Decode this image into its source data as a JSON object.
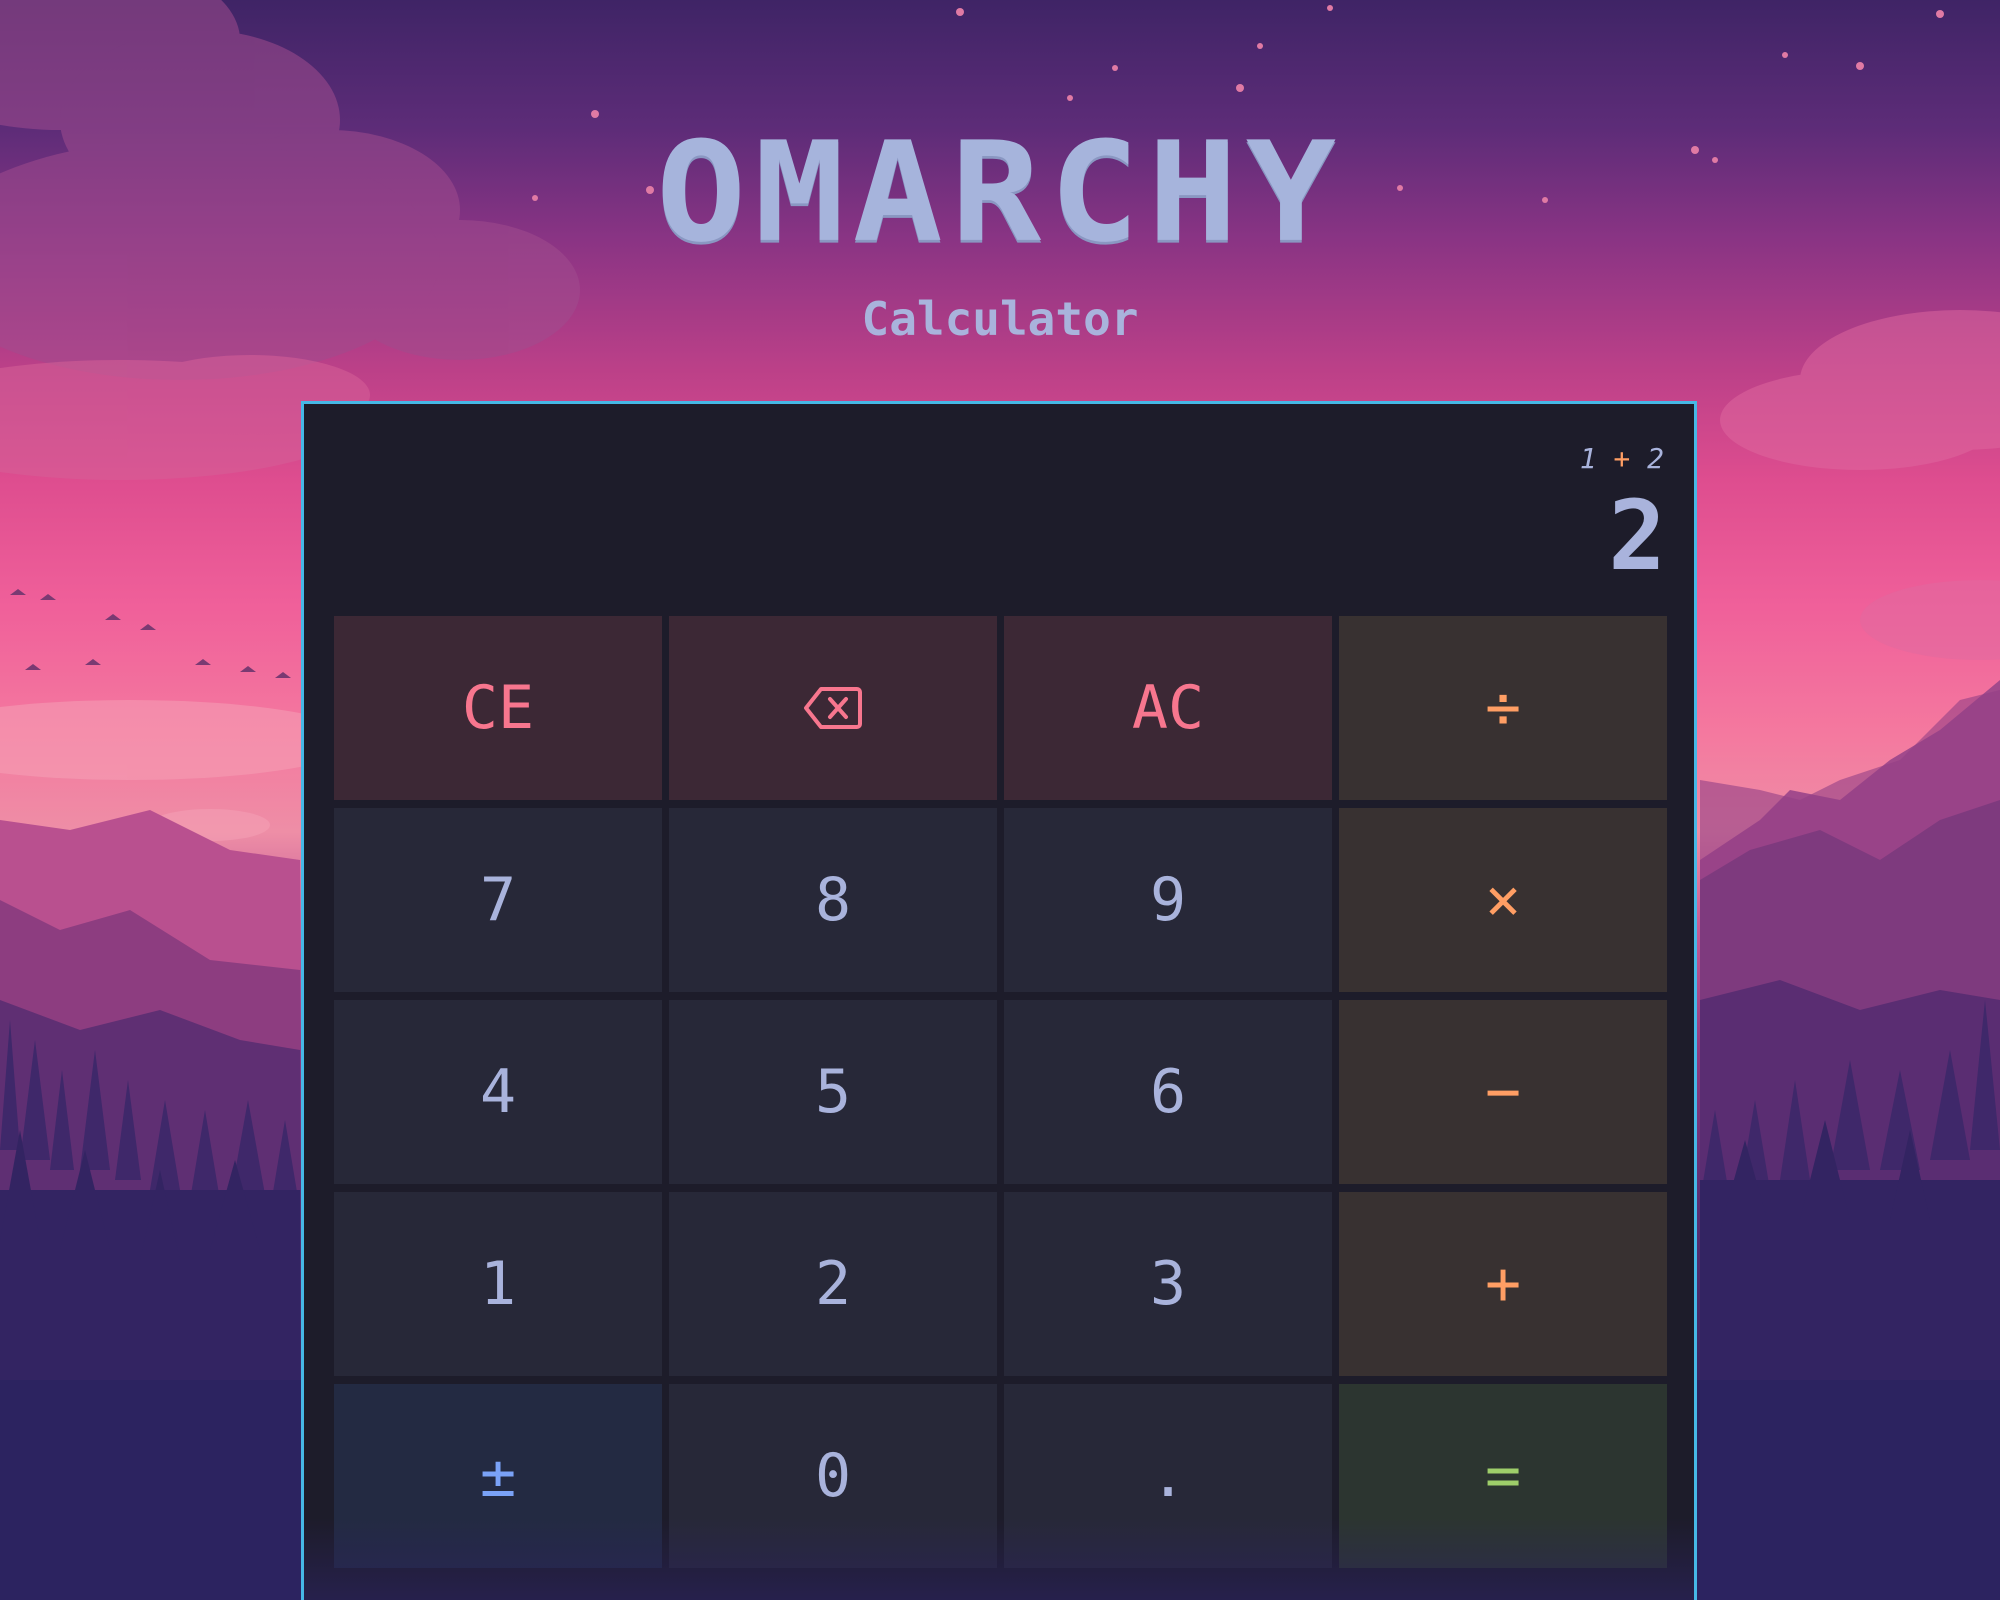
{
  "app": {
    "logo": "OMARCHY",
    "subtitle": "Calculator"
  },
  "display": {
    "expression_left": "1",
    "expression_op": "+",
    "expression_right": "2",
    "result": "2"
  },
  "keys": [
    {
      "label": "CE",
      "kind": "clear",
      "name": "clear-entry-button"
    },
    {
      "label": "",
      "icon": "backspace-icon",
      "kind": "clear",
      "name": "backspace-button"
    },
    {
      "label": "AC",
      "kind": "clear",
      "name": "all-clear-button"
    },
    {
      "label": "÷",
      "kind": "op",
      "name": "divide-button"
    },
    {
      "label": "7",
      "kind": "num",
      "name": "digit-7-button"
    },
    {
      "label": "8",
      "kind": "num",
      "name": "digit-8-button"
    },
    {
      "label": "9",
      "kind": "num",
      "name": "digit-9-button"
    },
    {
      "label": "×",
      "kind": "op",
      "name": "multiply-button"
    },
    {
      "label": "4",
      "kind": "num",
      "name": "digit-4-button"
    },
    {
      "label": "5",
      "kind": "num",
      "name": "digit-5-button"
    },
    {
      "label": "6",
      "kind": "num",
      "name": "digit-6-button"
    },
    {
      "label": "−",
      "kind": "op",
      "name": "subtract-button"
    },
    {
      "label": "1",
      "kind": "num",
      "name": "digit-1-button"
    },
    {
      "label": "2",
      "kind": "num",
      "name": "digit-2-button"
    },
    {
      "label": "3",
      "kind": "num",
      "name": "digit-3-button"
    },
    {
      "label": "+",
      "kind": "op",
      "name": "add-button"
    },
    {
      "label": "±",
      "kind": "sign",
      "name": "toggle-sign-button"
    },
    {
      "label": "0",
      "kind": "num",
      "name": "digit-0-button"
    },
    {
      "label": ".",
      "kind": "num",
      "name": "decimal-button"
    },
    {
      "label": "=",
      "kind": "eq",
      "name": "equals-button"
    }
  ],
  "colors": {
    "accent_border": "#46b8e6",
    "clear_text": "#f7768e",
    "operator_text": "#ff9e64",
    "number_text": "#a9b3dc",
    "sign_text": "#7aa2f7",
    "equals_text": "#9ece6a",
    "panel_background": "#1d1c2a"
  }
}
